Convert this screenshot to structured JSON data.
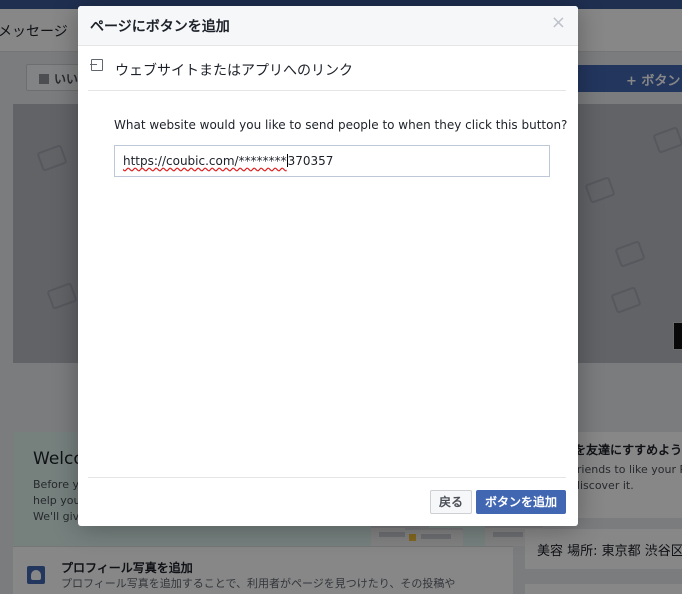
{
  "background": {
    "nav_label": "メッセージ",
    "like_button": "いい",
    "add_button": "+ ボタン",
    "welcome": {
      "title": "Welco",
      "lines": [
        "Before y",
        "help you",
        "We'll giv"
      ]
    },
    "recommend": {
      "title": "を友達にすすめよう",
      "lines": [
        "friends to like your P",
        "discover it."
      ]
    },
    "category": "美容 場所: 東京都 渋谷区",
    "profile": {
      "title": "プロフィール写真を追加",
      "desc": "プロフィール写真を追加することで、利用者がページを見つけたり、その投稿や"
    }
  },
  "modal": {
    "title": "ページにボタンを追加",
    "close": "×",
    "section_title": "ウェブサイトまたはアプリへのリンク",
    "question": "What website would you like to send people to when they click this button?",
    "url_value_before_caret": "https://coubic.com/********",
    "url_value_after_caret": "370357",
    "back_label": "戻る",
    "add_label": "ボタンを追加"
  },
  "colors": {
    "brand": "#3b5998",
    "primary_button": "#4267b2",
    "overlay": "rgba(0,0,0,0.47)"
  }
}
